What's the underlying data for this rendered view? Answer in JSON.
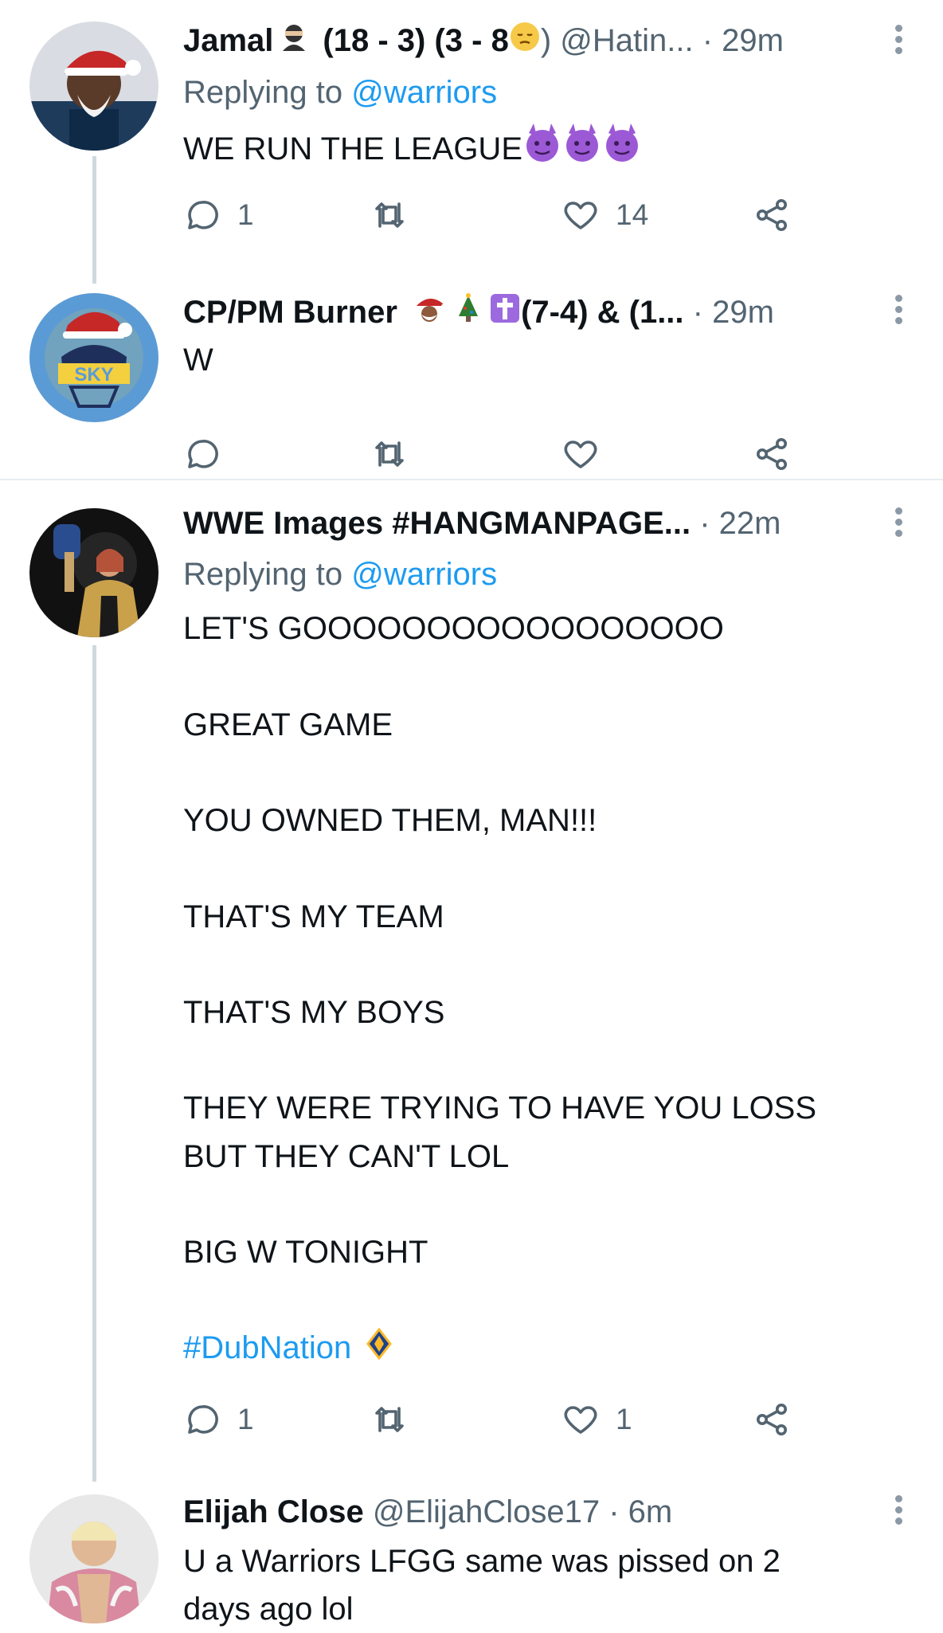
{
  "tweets": [
    {
      "name": "Jamal",
      "handle_meta": "(18 - 3) (3 - 8",
      "handle_meta_end": ") @Hatin...",
      "time": "· 29m",
      "reply_prefix": "Replying to",
      "reply_to": "@warriors",
      "text": "WE RUN THE LEAGUE",
      "replies": "1",
      "likes": "14"
    },
    {
      "name": "CP/PM Burner",
      "handle_meta": "(7-4) & (1...",
      "time": "· 29m",
      "text": "W",
      "avatar_label": "SKY"
    },
    {
      "name": "WWE Images #HANGMANPAGE...",
      "time": "· 22m",
      "reply_prefix": "Replying to",
      "reply_to": "@warriors",
      "lines": [
        "LET'S GOOOOOOOOOOOOOOOOO",
        "GREAT GAME",
        "YOU OWNED THEM, MAN!!!",
        "THAT'S MY TEAM",
        "THAT'S MY BOYS",
        "THEY WERE TRYING TO HAVE YOU LOSS",
        "BUT THEY CAN'T LOL",
        "BIG W TONIGHT"
      ],
      "hashtag": "#DubNation",
      "replies": "1",
      "likes": "1"
    },
    {
      "name": "Elijah Close",
      "handle": "@ElijahClose17",
      "time": "· 6m",
      "text_line1": "U a Warriors LFGG same was pissed on 2",
      "text_line2": "days ago lol"
    }
  ],
  "icons": {
    "reply": "reply-icon",
    "retweet": "retweet-icon",
    "like": "heart-icon",
    "share": "share-icon",
    "more": "more-vertical-icon"
  },
  "colors": {
    "link": "#1d9bf0",
    "secondary": "#536471",
    "text": "#0f1419"
  }
}
